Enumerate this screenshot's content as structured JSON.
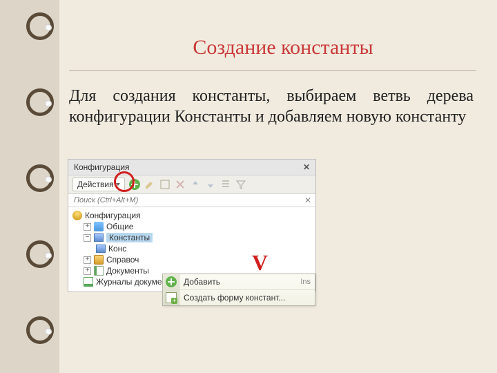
{
  "slide": {
    "title": "Создание константы",
    "body": "Для создания константы, выбираем ветвь дерева конфигурации Константы и добавляем новую константу"
  },
  "window": {
    "title": "Конфигурация",
    "actions_label": "Действия",
    "search_placeholder": "Поиск (Ctrl+Alt+M)"
  },
  "tree": {
    "root": "Конфигурация",
    "items": [
      {
        "label": "Общие"
      },
      {
        "label": "Константы",
        "selected": true
      },
      {
        "label": "Конс"
      },
      {
        "label": "Справоч"
      },
      {
        "label": "Документы"
      },
      {
        "label": "Журналы документов"
      }
    ]
  },
  "context_menu": {
    "add_label": "Добавить",
    "add_shortcut": "Ins",
    "create_form_label": "Создать форму констант..."
  },
  "annotations": {
    "checkmark": "V"
  }
}
